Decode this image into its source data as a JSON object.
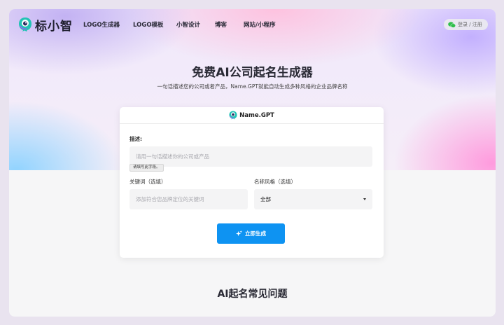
{
  "nav": {
    "brand": "标小智",
    "items": [
      {
        "label": "LOGO生成器"
      },
      {
        "label": "LOGO模板"
      },
      {
        "label": "小智设计"
      },
      {
        "label": "博客"
      },
      {
        "label": "网站/小程序"
      }
    ],
    "login_label": "登录 / 注册",
    "login_icon": "wechat-icon"
  },
  "hero": {
    "title": "免费AI公司起名生成器",
    "subtitle": "一句话描述您的公司或者产品，Name.GPT就能自动生成多种风格的企业品牌名称"
  },
  "card": {
    "header": "Name.GPT",
    "description": {
      "label": "描述:",
      "placeholder": "请用一句话描述你的公司或产品",
      "value": "",
      "tooltip": "请填写此字段。"
    },
    "keywords": {
      "label": "关键词（选填）",
      "placeholder": "添加符合您品牌定位的关键词",
      "value": ""
    },
    "style": {
      "label": "名称风格（选填）",
      "selected": "全部"
    },
    "submit_label": "立即生成"
  },
  "faq": {
    "title": "AI起名常见问题"
  },
  "colors": {
    "accent": "#0e93f2",
    "brand_teal": "#22c3b5"
  }
}
